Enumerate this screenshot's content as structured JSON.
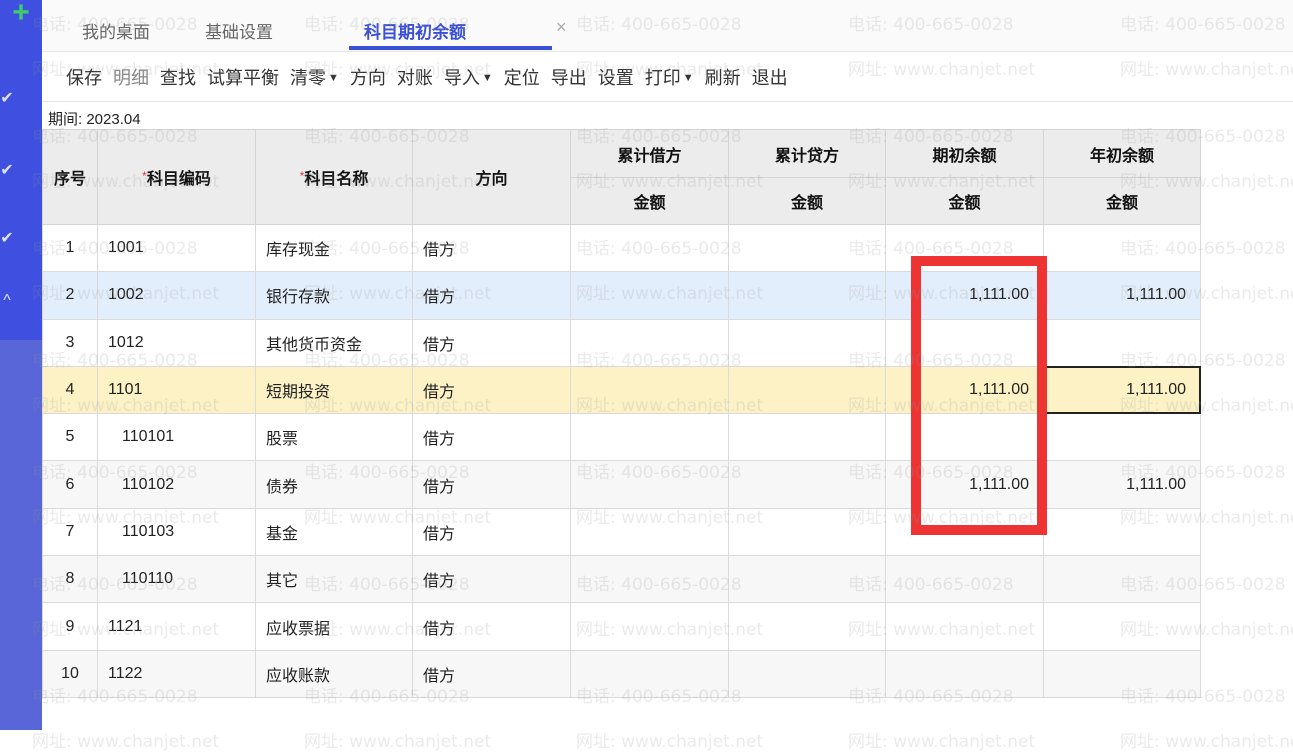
{
  "sidebar": {
    "icons": [
      "plus-icon",
      "check-icon",
      "check-icon",
      "check-icon",
      "caret-up-icon"
    ]
  },
  "tabs": [
    {
      "label": "我的桌面"
    },
    {
      "label": "基础设置"
    },
    {
      "label": "科目期初余额",
      "active": true
    }
  ],
  "tab_close": "×",
  "toolbar": {
    "items": [
      {
        "label": "保存"
      },
      {
        "label": "明细",
        "disabled": true
      },
      {
        "label": "查找"
      },
      {
        "label": "试算平衡"
      },
      {
        "label": "清零",
        "dropdown": true
      },
      {
        "label": "方向"
      },
      {
        "label": "对账"
      },
      {
        "label": "导入",
        "dropdown": true
      },
      {
        "label": "定位"
      },
      {
        "label": "导出"
      },
      {
        "label": "设置"
      },
      {
        "label": "打印",
        "dropdown": true
      },
      {
        "label": "刷新"
      },
      {
        "label": "退出"
      }
    ]
  },
  "period": "期间: 2023.04",
  "table": {
    "headers": {
      "seq": "序号",
      "code": "科目编码",
      "name": "科目名称",
      "dir": "方向",
      "debit": "累计借方",
      "credit": "累计贷方",
      "opening": "期初余额",
      "year_opening": "年初余额",
      "amount": "金额"
    },
    "required_mark": "*",
    "rows": [
      {
        "seq": "1",
        "code": "1001",
        "name": "库存现金",
        "dir": "借方",
        "debit": "",
        "credit": "",
        "opening": "",
        "year": ""
      },
      {
        "seq": "2",
        "code": "1002",
        "name": "银行存款",
        "dir": "借方",
        "debit": "",
        "credit": "",
        "opening": "1,111.00",
        "year": "1,111.00",
        "state": "hover"
      },
      {
        "seq": "3",
        "code": "1012",
        "name": "其他货币资金",
        "dir": "借方",
        "debit": "",
        "credit": "",
        "opening": "",
        "year": ""
      },
      {
        "seq": "4",
        "code": "1101",
        "name": "短期投资",
        "dir": "借方",
        "debit": "",
        "credit": "",
        "opening": "1,111.00",
        "year": "1,111.00",
        "state": "sel"
      },
      {
        "seq": "5",
        "code": "110101",
        "name": "股票",
        "dir": "借方",
        "debit": "",
        "credit": "",
        "opening": "",
        "year": "",
        "indent": true
      },
      {
        "seq": "6",
        "code": "110102",
        "name": "债券",
        "dir": "借方",
        "debit": "",
        "credit": "",
        "opening": "1,111.00",
        "year": "1,111.00",
        "indent": true,
        "state": "stripe"
      },
      {
        "seq": "7",
        "code": "110103",
        "name": "基金",
        "dir": "借方",
        "debit": "",
        "credit": "",
        "opening": "",
        "year": "",
        "indent": true
      },
      {
        "seq": "8",
        "code": "110110",
        "name": "其它",
        "dir": "借方",
        "debit": "",
        "credit": "",
        "opening": "",
        "year": "",
        "indent": true,
        "state": "stripe"
      },
      {
        "seq": "9",
        "code": "1121",
        "name": "应收票据",
        "dir": "借方",
        "debit": "",
        "credit": "",
        "opening": "",
        "year": ""
      },
      {
        "seq": "10",
        "code": "1122",
        "name": "应收账款",
        "dir": "借方",
        "debit": "",
        "credit": "",
        "opening": "",
        "year": "",
        "state": "stripe"
      }
    ]
  },
  "watermark": {
    "phone": "电话: 400-665-0028",
    "url": "网址: www.chanjet.net"
  },
  "colors": {
    "accent": "#3a4fd8",
    "highlight": "#ee3333"
  }
}
